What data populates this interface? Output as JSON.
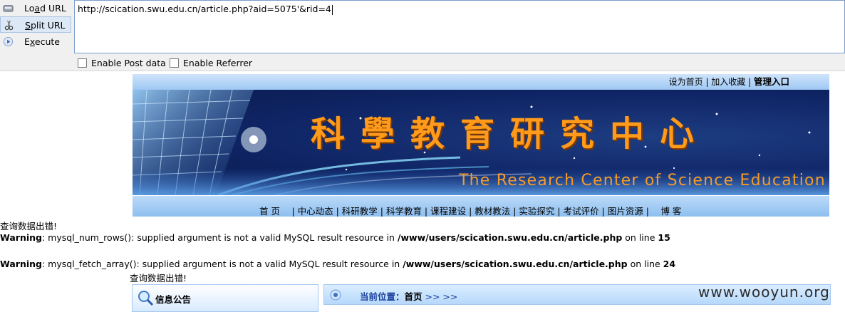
{
  "hackbar": {
    "buttons": [
      {
        "label_pre": "Lo",
        "label_u": "a",
        "label_post": "d URL"
      },
      {
        "label_pre": "",
        "label_u": "S",
        "label_post": "plit URL"
      },
      {
        "label_pre": "E",
        "label_u": "x",
        "label_post": "ecute"
      }
    ],
    "url": "http://scication.swu.edu.cn/article.php?aid=5075'&rid=4",
    "enable_post": "Enable Post data",
    "enable_referrer": "Enable Referrer"
  },
  "site": {
    "top_links": {
      "home": "设为首页",
      "sep1": " | ",
      "fav": "加入收藏",
      "sep2": " | ",
      "admin": "管理入口"
    },
    "banner_cn": "科學教育研究中心",
    "banner_en": "The Research Center of Science Education",
    "nav": "首 页　 | 中心动态 | 科研教学 | 科学教育 | 课程建设 | 教材教法 | 实验探究 | 考试评价 | 图片资源 |　 博 客"
  },
  "errors": {
    "query_error": "查询数据出错!",
    "warn1": {
      "label": "Warning",
      "msg": ": mysql_num_rows(): supplied argument is not a valid MySQL result resource in ",
      "file": "/www/users/scication.swu.edu.cn/article.php",
      "online": " on line ",
      "line": "15"
    },
    "warn2": {
      "label": "Warning",
      "msg": ": mysql_fetch_array(): supplied argument is not a valid MySQL result resource in ",
      "file": "/www/users/scication.swu.edu.cn/article.php",
      "online": " on line ",
      "line": "24"
    },
    "query_error2": "查询数据出错!"
  },
  "panels": {
    "info_title": "信息公告",
    "position_label": "当前位置：",
    "position_home": "首页",
    "position_arrows": " >> >>"
  },
  "watermark": "www.wooyun.org"
}
